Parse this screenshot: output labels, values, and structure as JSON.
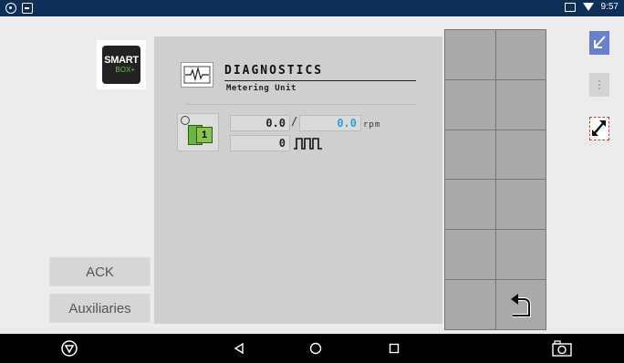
{
  "status_bar": {
    "time": "9:57"
  },
  "logo": {
    "line1": "SMART",
    "line2": "BOX+"
  },
  "side_buttons": {
    "ack": "ACK",
    "auxiliaries": "Auxiliaries"
  },
  "diagnostics": {
    "title": "DIAGNOSTICS",
    "subtitle": "Metering Unit",
    "unit_number": "1",
    "actual_rpm": "0.0",
    "target_rpm": "0.0",
    "rpm_unit": "rpm",
    "pulses": "0"
  },
  "colors": {
    "status_bar": "#0d2f57",
    "target_value": "#2aa3d6",
    "accent_blue": "#6b7fd0",
    "accent_red": "#d23a3a"
  },
  "icons": [
    "eye-icon",
    "notification-icon",
    "cast-icon",
    "wifi-icon",
    "diagnostics-waveform-icon",
    "metering-unit-icon",
    "pulse-icon",
    "back-return-icon",
    "minimize-arrow-icon",
    "more-menu-icon",
    "fullscreen-toggle-icon",
    "power-icon",
    "nav-back-icon",
    "nav-home-icon",
    "nav-recents-icon",
    "screenshot-icon"
  ]
}
